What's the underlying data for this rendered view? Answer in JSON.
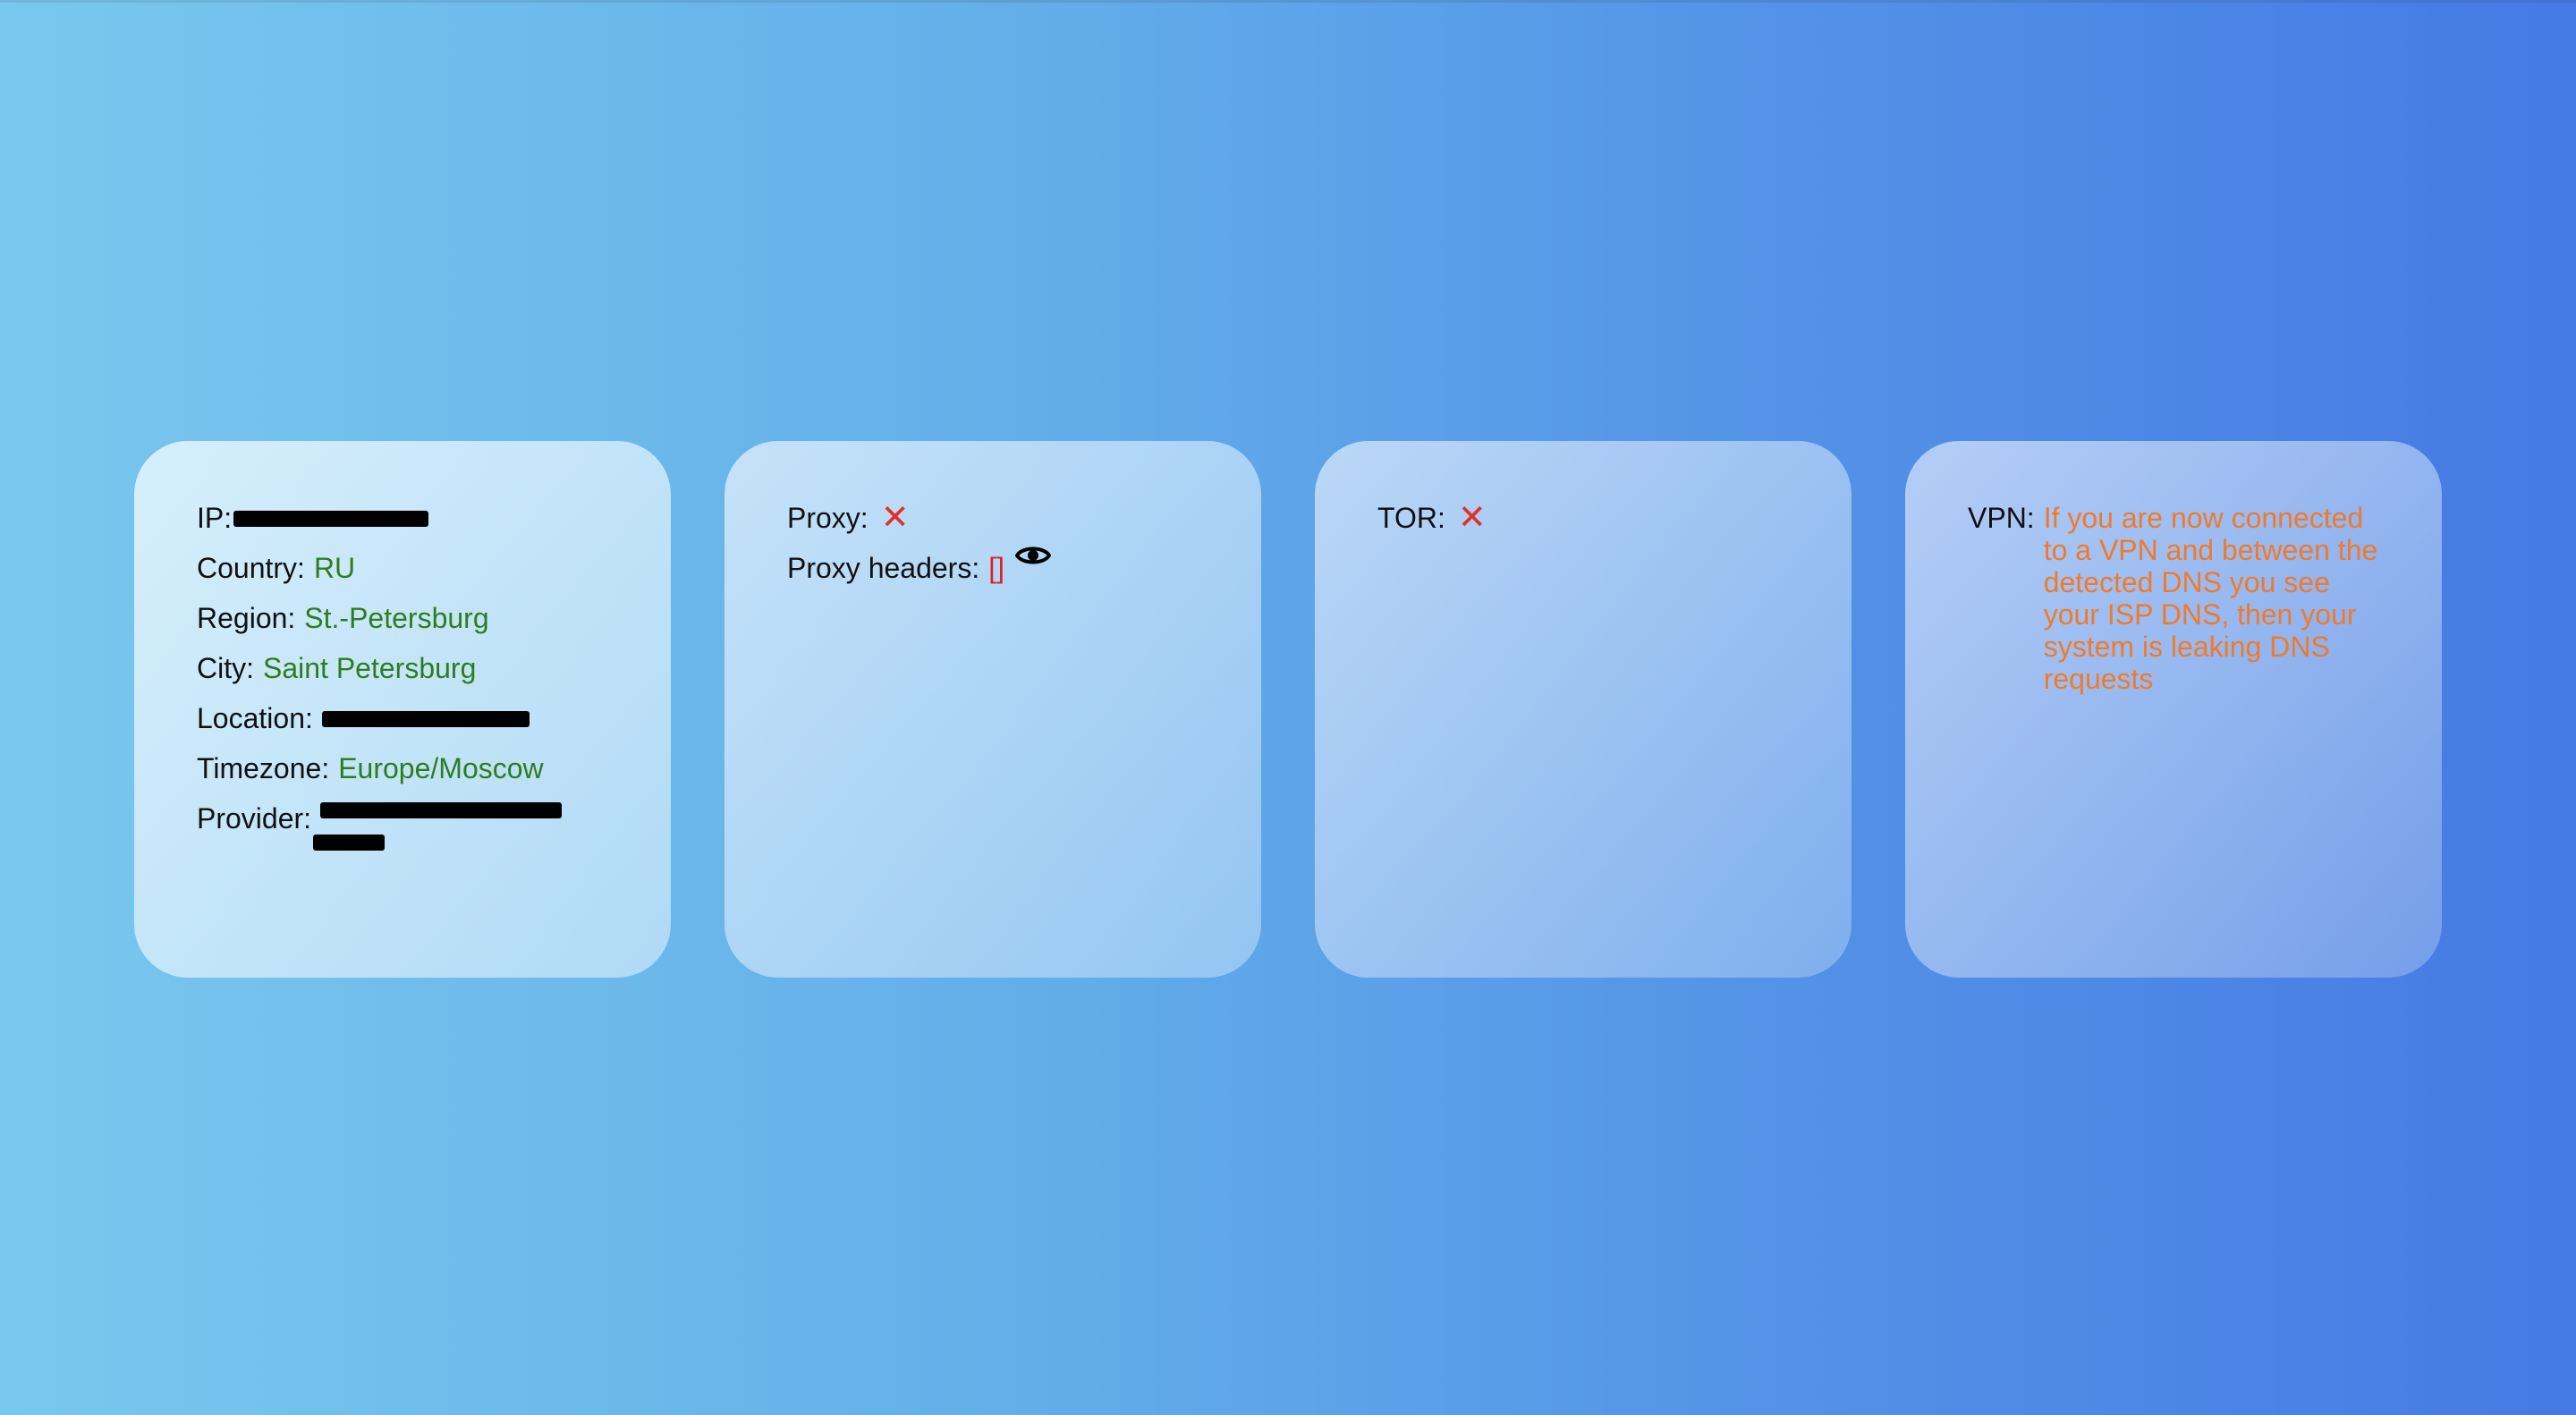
{
  "card1": {
    "ip_label": "IP:",
    "country_label": "Country:",
    "country_value": "RU",
    "region_label": "Region:",
    "region_value": "St.-Petersburg",
    "city_label": "City:",
    "city_value": "Saint Petersburg",
    "location_label": "Location:",
    "timezone_label": "Timezone:",
    "timezone_value": "Europe/Moscow",
    "provider_label": "Provider:"
  },
  "card2": {
    "proxy_label": "Proxy:",
    "proxy_status": "✕",
    "headers_label": "Proxy headers:",
    "headers_value": "[]"
  },
  "card3": {
    "tor_label": "TOR:",
    "tor_status": "✕"
  },
  "card4": {
    "vpn_label": "VPN:",
    "vpn_message": "If you are now connected to a VPN and between the detected DNS you see your ISP DNS, then your system is leaking DNS requests"
  },
  "icons": {
    "status_cross": "cross-icon",
    "reveal": "eye-icon"
  },
  "colors": {
    "ok_value": "#2e7d1f",
    "fail": "#e02020",
    "warning": "#f07a2a"
  }
}
